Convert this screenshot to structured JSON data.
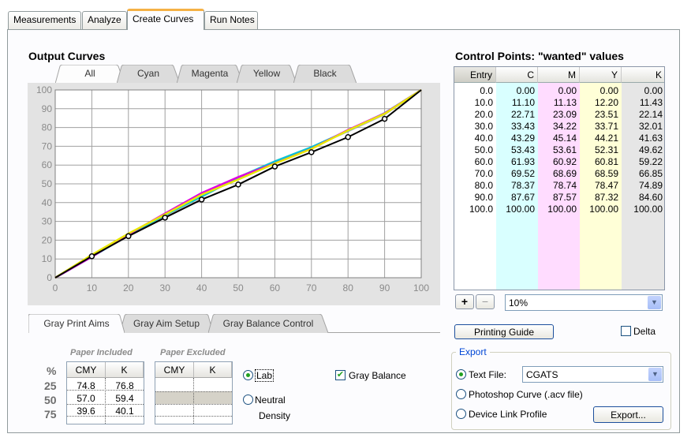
{
  "top_tabs": [
    {
      "label": "Measurements"
    },
    {
      "label": "Analyze"
    },
    {
      "label": "Create Curves"
    },
    {
      "label": "Run Notes"
    }
  ],
  "output_curves": {
    "title": "Output Curves",
    "tabs": [
      {
        "label": "All"
      },
      {
        "label": "Cyan"
      },
      {
        "label": "Magenta"
      },
      {
        "label": "Yellow"
      },
      {
        "label": "Black"
      }
    ],
    "active_tab": "All"
  },
  "chart_data": {
    "type": "line",
    "xlim": [
      0,
      100
    ],
    "ylim": [
      0,
      100
    ],
    "xticks": [
      0,
      10,
      20,
      30,
      40,
      50,
      60,
      70,
      80,
      90,
      100
    ],
    "yticks": [
      0,
      10,
      20,
      30,
      40,
      50,
      60,
      70,
      80,
      90,
      100
    ],
    "grid": true,
    "x": [
      0,
      10,
      20,
      30,
      40,
      50,
      60,
      70,
      80,
      90,
      100
    ],
    "series": [
      {
        "color": "#8a8a8a",
        "values": [
          0,
          12,
          23,
          33,
          43,
          53.5,
          62,
          69.5,
          78,
          87,
          100
        ],
        "line": true
      },
      {
        "color": "#00c8d8",
        "values": [
          0,
          11.1,
          22.71,
          33.43,
          43.29,
          53.43,
          61.93,
          69.52,
          78.37,
          87.67,
          100
        ],
        "line": true
      },
      {
        "color": "#e000e0",
        "values": [
          0,
          11.13,
          23.09,
          34.22,
          45.14,
          53.61,
          60.92,
          68.69,
          78.74,
          87.57,
          100
        ],
        "line": true
      },
      {
        "color": "#e8e800",
        "values": [
          0,
          12.2,
          23.51,
          33.71,
          44.21,
          52.31,
          60.81,
          68.59,
          78.47,
          87.32,
          100
        ],
        "line": true
      },
      {
        "color": "#000000",
        "values": [
          0,
          11.43,
          22.14,
          32.01,
          41.63,
          49.62,
          59.22,
          66.85,
          74.89,
          84.6,
          100
        ],
        "line": true
      }
    ]
  },
  "control_points": {
    "title": "Control Points: \"wanted\" values",
    "columns": [
      "Entry",
      "C",
      "M",
      "Y",
      "K"
    ],
    "column_colors": [
      "#ffffff",
      "#d9ffff",
      "#ffdcff",
      "#ffffd7",
      "#e6e6e6"
    ],
    "rows": [
      [
        "0.0",
        "0.00",
        "0.00",
        "0.00",
        "0.00"
      ],
      [
        "10.0",
        "11.10",
        "11.13",
        "12.20",
        "11.43"
      ],
      [
        "20.0",
        "22.71",
        "23.09",
        "23.51",
        "22.14"
      ],
      [
        "30.0",
        "33.43",
        "34.22",
        "33.71",
        "32.01"
      ],
      [
        "40.0",
        "43.29",
        "45.14",
        "44.21",
        "41.63"
      ],
      [
        "50.0",
        "53.43",
        "53.61",
        "52.31",
        "49.62"
      ],
      [
        "60.0",
        "61.93",
        "60.92",
        "60.81",
        "59.22"
      ],
      [
        "70.0",
        "69.52",
        "68.69",
        "68.59",
        "66.85"
      ],
      [
        "80.0",
        "78.37",
        "78.74",
        "78.47",
        "74.89"
      ],
      [
        "90.0",
        "87.67",
        "87.57",
        "87.32",
        "84.60"
      ],
      [
        "100.0",
        "100.00",
        "100.00",
        "100.00",
        "100.00"
      ]
    ],
    "add_label": "+",
    "remove_label": "−",
    "step_value": "10%"
  },
  "printing_guide_label": "Printing Guide",
  "delta_label": "Delta",
  "export": {
    "title": "Export",
    "options": [
      {
        "label": "Text File:",
        "selected": true
      },
      {
        "label": "Photoshop Curve (.acv file)",
        "selected": false
      },
      {
        "label": "Device Link Profile",
        "selected": false
      }
    ],
    "format_value": "CGATS",
    "export_button": "Export..."
  },
  "gray_tabs": [
    {
      "label": "Gray Print Aims"
    },
    {
      "label": "Gray Aim Setup"
    },
    {
      "label": "Gray Balance Control"
    }
  ],
  "gray_aims": {
    "percent_label": "%",
    "row_labels": [
      "25",
      "50",
      "75"
    ],
    "paper_included": {
      "title": "Paper Included",
      "cols": [
        "CMY",
        "K"
      ],
      "rows": [
        [
          "74.8",
          "76.8"
        ],
        [
          "57.0",
          "59.4"
        ],
        [
          "39.6",
          "40.1"
        ]
      ]
    },
    "paper_excluded": {
      "title": "Paper Excluded",
      "cols": [
        "CMY",
        "K"
      ]
    },
    "lab_label": "Lab",
    "neutral_label_1": "Neutral",
    "neutral_label_2": "Density",
    "gray_balance_label": "Gray Balance"
  }
}
